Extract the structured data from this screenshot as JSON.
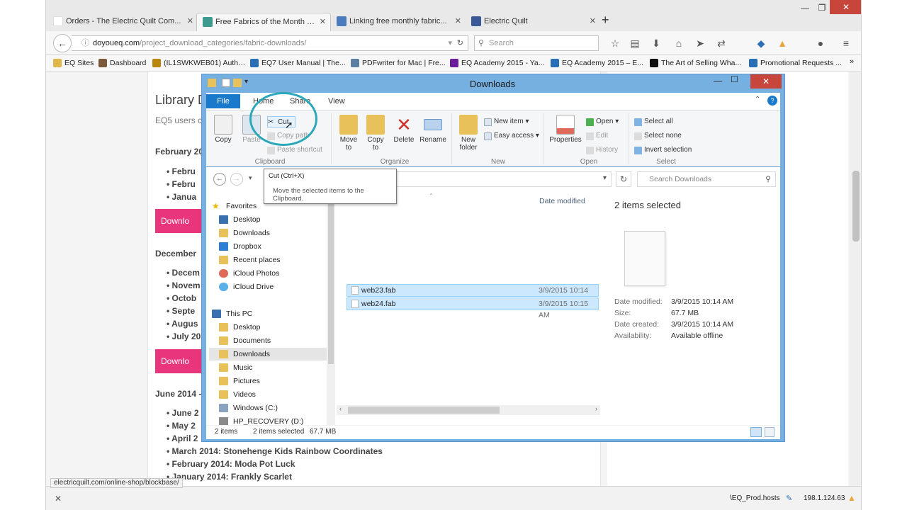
{
  "browser": {
    "tabs": [
      {
        "label": "Orders - The Electric Quilt Com...",
        "color": "#ffffff"
      },
      {
        "label": "Free Fabrics of the Month |...",
        "color": "#3c9a8f"
      },
      {
        "label": "Linking free monthly fabric...",
        "color": "#4a7bbf"
      },
      {
        "label": "Electric Quilt",
        "color": "#3b5998"
      }
    ],
    "url_host": "doyoueq.com",
    "url_path": "/project_download_categories/fabric-downloads/",
    "search_placeholder": "Search",
    "bookmarks": [
      {
        "label": "EQ Sites",
        "color": "#e0b84a"
      },
      {
        "label": "Dashboard",
        "color": "#7a5a3a"
      },
      {
        "label": "(IL1SWKWEB01) Autho...",
        "color": "#b8860b"
      },
      {
        "label": "EQ7 User Manual | The...",
        "color": "#2a6fb5"
      },
      {
        "label": "PDFwriter for Mac | Fre...",
        "color": "#5a7fa0"
      },
      {
        "label": "EQ Academy 2015 - Ya...",
        "color": "#6a1b9a"
      },
      {
        "label": "EQ Academy 2015 – E...",
        "color": "#2a6fb5"
      },
      {
        "label": "The Art of Selling Wha...",
        "color": "#111111"
      },
      {
        "label": "Promotional Requests ...",
        "color": "#2a6fb5"
      }
    ],
    "status_url": "electricquilt.com/online-shop/blockbase/",
    "tray_text": "\\EQ_Prod.hosts",
    "tray_ip": "198.1.124.63"
  },
  "webpage": {
    "title": "Library D",
    "subtitle": "EQ5 users c",
    "sections": [
      {
        "heading": "February 20",
        "items": [
          "Febru",
          "Febru",
          "Janua"
        ],
        "button": "Downlo"
      },
      {
        "heading": "December",
        "items": [
          "Decem",
          "Novem",
          "Octob",
          "Septe",
          "Augus",
          "July 20"
        ],
        "button": "Downlo"
      },
      {
        "heading": "June 2014 -",
        "items": [
          "June 2",
          "May 2",
          "April 2",
          "March 2014: Stonehenge Kids Rainbow Coordinates",
          "February 2014: Moda Pot Luck",
          "January 2014: Frankly Scarlet"
        ]
      }
    ]
  },
  "explorer": {
    "title": "Downloads",
    "ribbon_tabs": [
      "File",
      "Home",
      "Share",
      "View"
    ],
    "ribbon": {
      "copy": "Copy",
      "paste": "Paste",
      "cut": "Cut",
      "copy_path": "Copy path",
      "paste_shortcut": "Paste shortcut",
      "move_to": "Move to",
      "copy_to": "Copy to",
      "delete": "Delete",
      "rename": "Rename",
      "new_folder": "New folder",
      "new_item": "New item",
      "easy_access": "Easy access",
      "properties": "Properties",
      "open": "Open",
      "edit": "Edit",
      "history": "History",
      "select_all": "Select all",
      "select_none": "Select none",
      "invert_selection": "Invert selection",
      "groups": [
        "Clipboard",
        "Organize",
        "New",
        "Open",
        "Select"
      ]
    },
    "search_placeholder": "Search Downloads",
    "tooltip": {
      "title": "Cut (Ctrl+X)",
      "body": "Move the selected items to the Clipboard."
    },
    "nav": {
      "favorites_label": "Favorites",
      "favorites": [
        {
          "label": "Desktop",
          "color": "#3a6fb0"
        },
        {
          "label": "Downloads",
          "color": "#e8c15a"
        },
        {
          "label": "Dropbox",
          "color": "#2d7fd3"
        },
        {
          "label": "Recent places",
          "color": "#e8c15a"
        },
        {
          "label": "iCloud Photos",
          "color": "#e06a5a"
        },
        {
          "label": "iCloud Drive",
          "color": "#5ab0e8"
        }
      ],
      "this_pc_label": "This PC",
      "this_pc": [
        {
          "label": "Desktop",
          "color": "#e8c15a"
        },
        {
          "label": "Documents",
          "color": "#e8c15a"
        },
        {
          "label": "Downloads",
          "color": "#e8c15a"
        },
        {
          "label": "Music",
          "color": "#e8c15a"
        },
        {
          "label": "Pictures",
          "color": "#e8c15a"
        },
        {
          "label": "Videos",
          "color": "#e8c15a"
        },
        {
          "label": "Windows (C:)",
          "color": "#8aa4c0"
        },
        {
          "label": "HP_RECOVERY (D:)",
          "color": "#8a8a8a"
        }
      ]
    },
    "columns": {
      "date_modified": "Date modified"
    },
    "files": [
      {
        "name": "web23.fab",
        "date": "3/9/2015 10:14 AM"
      },
      {
        "name": "web24.fab",
        "date": "3/9/2015 10:15 AM"
      }
    ],
    "details": {
      "summary": "2 items selected",
      "rows": [
        {
          "label": "Date modified:",
          "value": "3/9/2015 10:14 AM"
        },
        {
          "label": "Size:",
          "value": "67.7 MB"
        },
        {
          "label": "Date created:",
          "value": "3/9/2015 10:14 AM"
        },
        {
          "label": "Availability:",
          "value": "Available offline"
        }
      ]
    },
    "status": {
      "count": "2 items",
      "selected": "2 items selected",
      "size": "67.7 MB"
    }
  }
}
